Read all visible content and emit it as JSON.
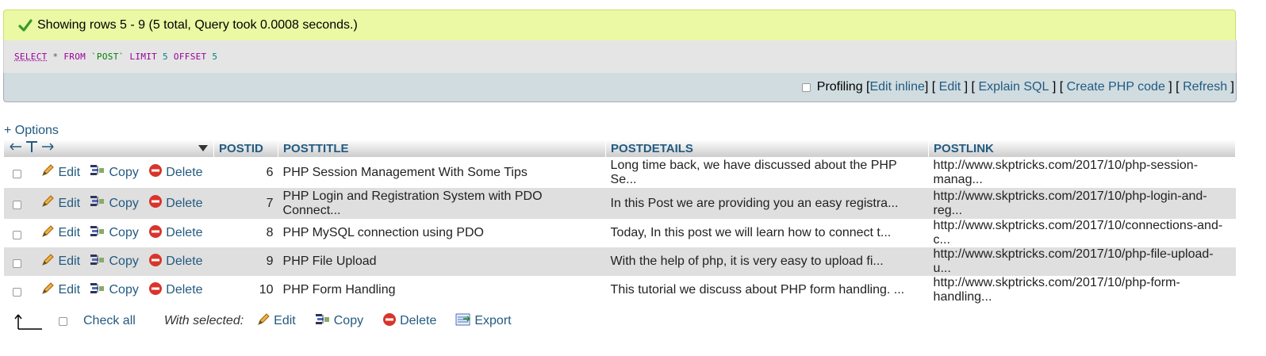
{
  "banner": {
    "message": "Showing rows 5 - 9 (5 total, Query took 0.0008 seconds.)",
    "icon": "check-icon"
  },
  "sql": {
    "select": "SELECT",
    "star": "*",
    "from": "FROM",
    "table": "`POST`",
    "limit": "LIMIT",
    "limit_val": "5",
    "offset": "OFFSET",
    "offset_val": "5"
  },
  "tools": {
    "profiling": "Profiling",
    "edit_inline": "Edit inline",
    "edit": "Edit",
    "explain_sql": "Explain SQL",
    "create_php": "Create PHP code",
    "refresh": "Refresh"
  },
  "options_label": "+ Options",
  "columns": [
    "POSTID",
    "POSTTITLE",
    "POSTDETAILS",
    "POSTLINK"
  ],
  "row_actions": {
    "edit": "Edit",
    "copy": "Copy",
    "delete": "Delete"
  },
  "rows": [
    {
      "id": "6",
      "title": "PHP Session Management With Some Tips",
      "details": "Long time back, we have discussed about the PHP Se...",
      "link": "http://www.skptricks.com/2017/10/php-session-manag..."
    },
    {
      "id": "7",
      "title": "PHP Login and Registration System with PDO Connect...",
      "details": "In this Post we are providing you an easy registra...",
      "link": "http://www.skptricks.com/2017/10/php-login-and-reg..."
    },
    {
      "id": "8",
      "title": "PHP MySQL connection using PDO",
      "details": "Today, In this post we will learn how to connect t...",
      "link": "http://www.skptricks.com/2017/10/connections-and-c..."
    },
    {
      "id": "9",
      "title": "PHP File Upload",
      "details": "With the help of php, it is very easy to upload fi...",
      "link": "http://www.skptricks.com/2017/10/php-file-upload-u..."
    },
    {
      "id": "10",
      "title": "PHP Form Handling",
      "details": "This tutorial we discuss about PHP form handling. ...",
      "link": "http://www.skptricks.com/2017/10/php-form-handling..."
    }
  ],
  "bottom": {
    "check_all": "Check all",
    "with_selected": "With selected:",
    "edit": "Edit",
    "copy": "Copy",
    "delete": "Delete",
    "export": "Export"
  },
  "colors": {
    "link": "#235a81",
    "banner_bg": "#ebf8a4",
    "row_alt_bg": "#dfdfdf"
  }
}
